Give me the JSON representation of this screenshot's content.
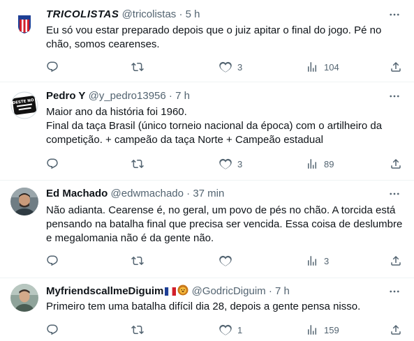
{
  "tweets": [
    {
      "name": "TRICOLISTAS",
      "handle": "@tricolistas",
      "separator": "·",
      "time": "5 h",
      "text_lines": [
        "Eu só vou estar preparado depois que o juiz apitar o final do jogo. Pé no chão, somos cearenses."
      ],
      "replies": "",
      "retweets": "",
      "likes": "3",
      "views": "104"
    },
    {
      "name": "Pedro Y",
      "handle": "@y_pedro13956",
      "separator": "·",
      "time": "7 h",
      "text_lines": [
        "Maior ano da história foi 1960.",
        "Final da taça Brasil (único torneio nacional da época) com o artilheiro da competição. + campeão da taça Norte + Campeão estadual"
      ],
      "replies": "",
      "retweets": "",
      "likes": "3",
      "views": "89"
    },
    {
      "name": "Ed Machado",
      "handle": "@edwmachado",
      "separator": "·",
      "time": "37 min",
      "text_lines": [
        "Não adianta. Cearense é, no geral, um povo de pés no chão. A torcida está pensando na batalha final que precisa ser vencida. Essa coisa de deslumbre e megalomania não é da gente não."
      ],
      "replies": "",
      "retweets": "",
      "likes": "",
      "views": "3"
    },
    {
      "name": "MyfriendscallmeDiguim",
      "handle": "@GodricDiguim",
      "separator": "·",
      "time": "7 h",
      "text_lines": [
        "Primeiro tem uma batalha difícil dia 28, depois a gente pensa nisso."
      ],
      "replies": "",
      "retweets": "",
      "likes": "1",
      "views": "159"
    }
  ],
  "avatars": {
    "t0": "shield-crest",
    "t1": "sticker-logo",
    "t2": "man-photo",
    "t3": "man-photo"
  },
  "avatar_text": "NORDESTE NO PAIS",
  "colors": {
    "text": "#0f1419",
    "secondary": "#536471",
    "divider": "#eff3f4",
    "crest_red": "#d21f2b",
    "crest_blue": "#1e3f95"
  }
}
